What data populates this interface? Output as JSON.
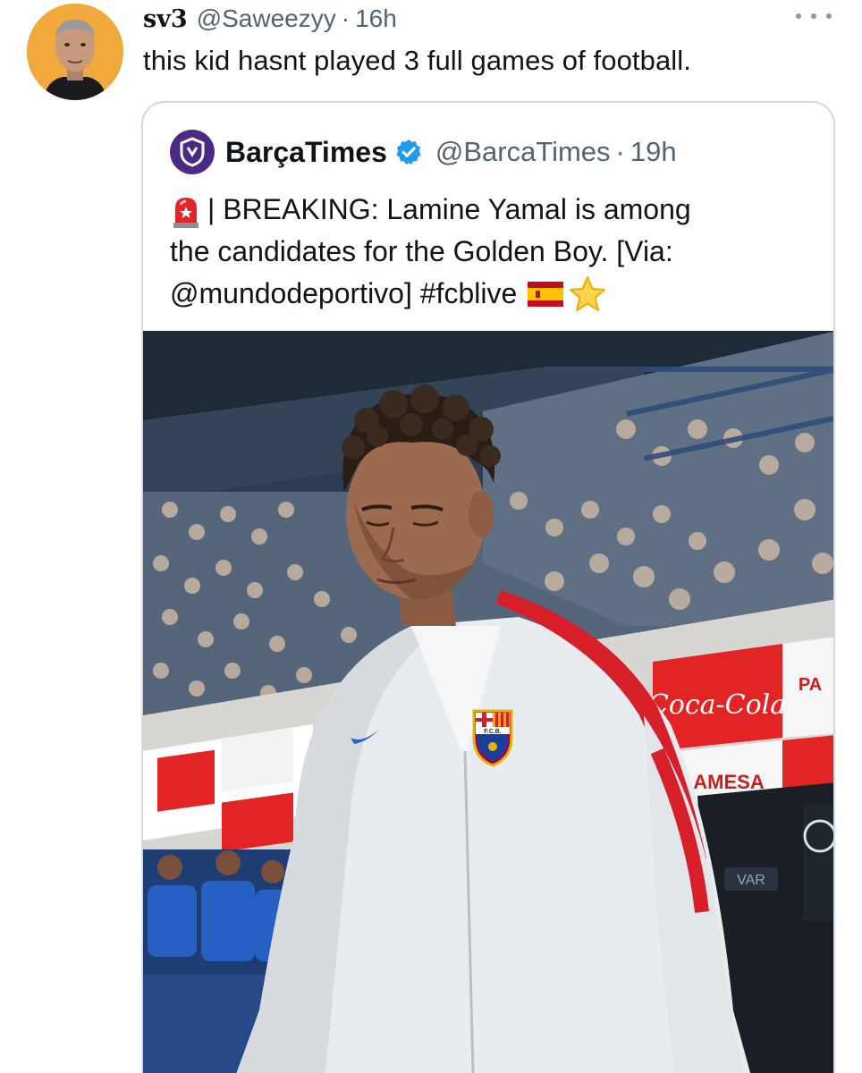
{
  "tweet": {
    "display_name": "sv3",
    "handle": "@Saweezyy",
    "separator": "·",
    "time": "16h",
    "text": "this kid hasnt played 3 full games of football."
  },
  "quote": {
    "display_name": "BarçaTimes",
    "handle": "@BarcaTimes",
    "separator": "·",
    "time": "19h",
    "line1": "| BREAKING: Lamine Yamal is among",
    "line2": "the candidates for the Golden Boy. [Via:",
    "line3": "@mundodeportivo] #fcblive",
    "verified_color": "#1d9bf0",
    "logo_color": "#4b2a85"
  },
  "media": {
    "ad_text_coca_cola": "Coca-Cola",
    "ad_text_pamesa": "AMESA",
    "ad_text_pa": "PA",
    "ad_text_var": "VAR",
    "crest_text": "F.C.B."
  },
  "icons": {
    "more": "more-horizontal-icon",
    "verified": "verified-badge-icon",
    "siren": "police-siren-emoji",
    "spain_flag": "spain-flag-emoji",
    "star": "star-emoji"
  }
}
